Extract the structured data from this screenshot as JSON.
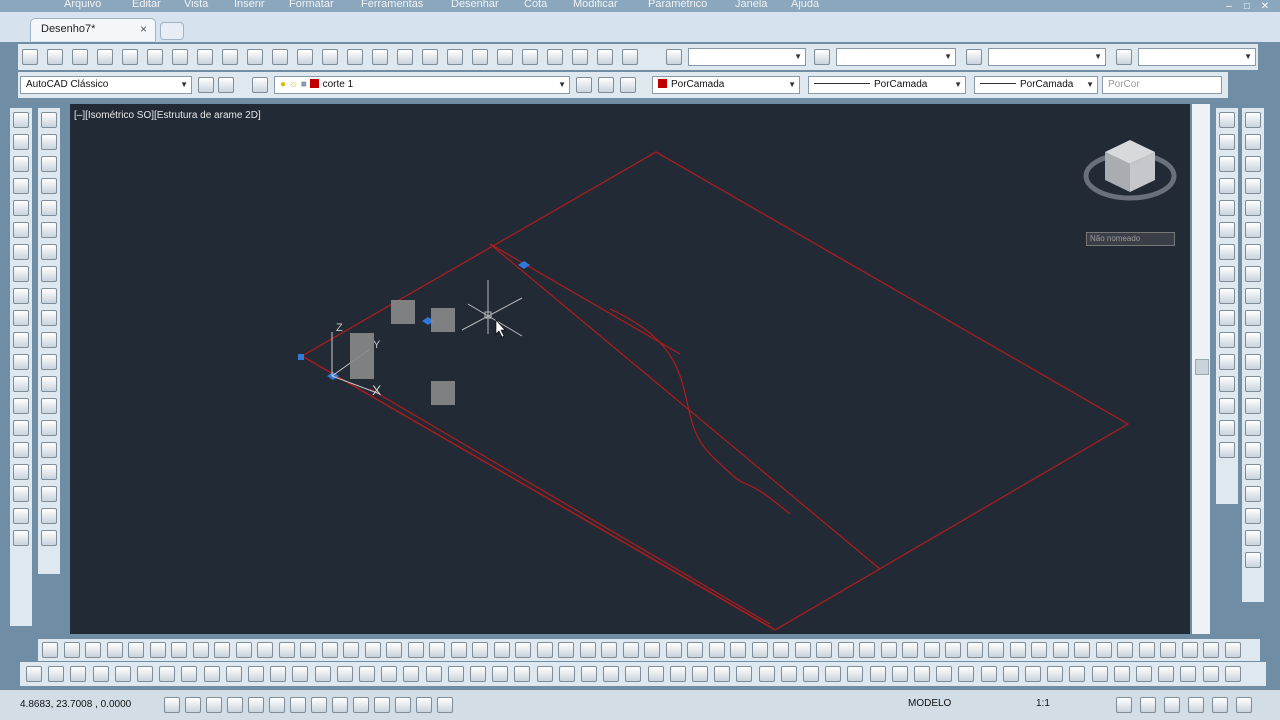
{
  "menubar": [
    "Arquivo",
    "Editar",
    "Vista",
    "Inserir",
    "Formatar",
    "Ferramentas",
    "Desenhar",
    "Cota",
    "Modificar",
    "Paramétrico",
    "Janela",
    "Ajuda"
  ],
  "window_controls": [
    "–",
    "□",
    "✕"
  ],
  "doc_tab": {
    "title": "Desenho7*",
    "close": "×"
  },
  "workspace": "AutoCAD Clássico",
  "layer": "corte 1",
  "color": "PorCamada",
  "linetype": "PorCamada",
  "lineweight": "PorCamada",
  "plotstyle": "PorCor",
  "viewport_label": "[–][Isométrico SO][Estrutura de arame 2D]",
  "viewcube_label": "Não nomeado",
  "coordinates": "4.8683, 23.7008 , 0.0000",
  "model_label": "MODELO",
  "annotation_scale": "1:1",
  "colors": {
    "drawing_lines": "#b31b1b",
    "viewport_bg": "#222a36",
    "grip": "#2f7ad8",
    "ucs_axes": "#c8c8c8"
  },
  "icons": {
    "toolbar_standard": [
      "new-icon",
      "open-icon",
      "save-icon",
      "print-icon",
      "plot-preview-icon",
      "publish-icon",
      "3d-print-icon",
      "cut-icon",
      "copy-icon",
      "paste-icon",
      "match-properties-icon",
      "block-editor-icon",
      "undo-icon",
      "redo-icon",
      "pan-icon",
      "zoom-realtime-icon",
      "zoom-window-icon",
      "zoom-previous-icon",
      "properties-icon",
      "design-center-icon",
      "tool-palettes-icon",
      "sheet-set-icon",
      "markup-icon",
      "quickcalc-icon",
      "help-icon"
    ],
    "toolbar_layers": [
      "workspace-settings-icon",
      "workspace-gear-icon",
      "layer-manager-icon",
      "bulb-icon",
      "sun-icon",
      "lock-icon",
      "layer-color-icon"
    ],
    "left_draw": [
      "line-icon",
      "construction-line-icon",
      "polyline-icon",
      "polygon-icon",
      "rectangle-icon",
      "arc-icon",
      "circle-icon",
      "revision-cloud-icon",
      "spline-icon",
      "ellipse-icon",
      "ellipse-arc-icon",
      "insert-block-icon",
      "make-block-icon",
      "point-icon",
      "hatch-icon",
      "gradient-icon",
      "region-icon",
      "table-icon",
      "multiline-text-icon",
      "add-selected-icon"
    ],
    "right_modify": [
      "erase-icon",
      "copy-object-icon",
      "mirror-icon",
      "offset-icon",
      "array-icon",
      "move-icon",
      "rotate-icon",
      "scale-icon",
      "stretch-icon",
      "trim-icon",
      "extend-icon",
      "break-icon",
      "join-icon",
      "chamfer-icon",
      "fillet-icon",
      "explode-icon"
    ]
  }
}
